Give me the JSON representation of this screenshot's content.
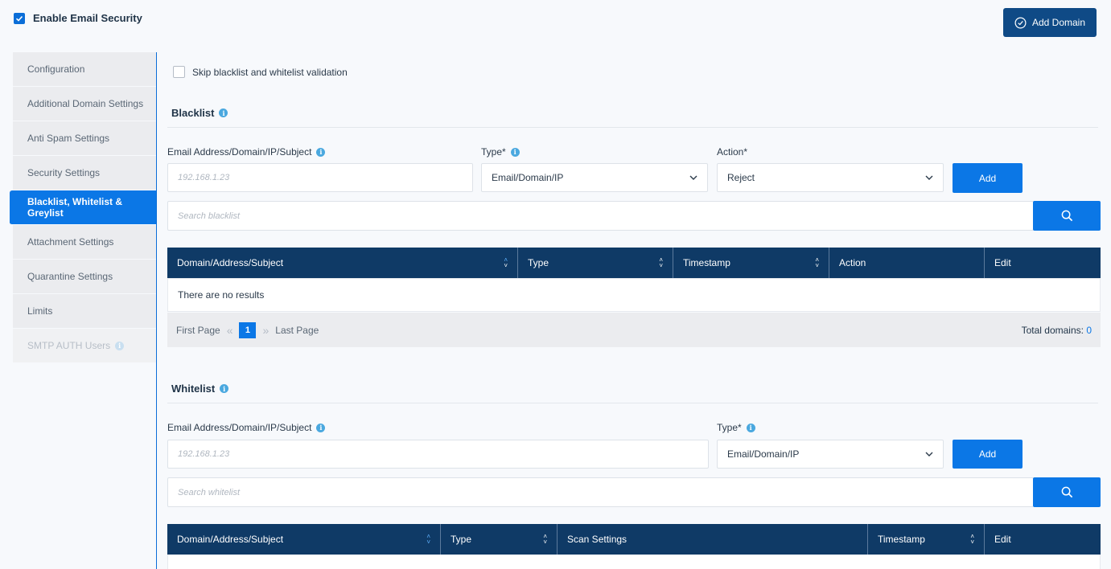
{
  "enable": {
    "label": "Enable Email Security",
    "checked": true
  },
  "add_domain": {
    "label": "Add Domain",
    "icon": "check-circle-icon"
  },
  "sidebar": {
    "items": [
      {
        "label": "Configuration",
        "state": "normal"
      },
      {
        "label": "Additional Domain Settings",
        "state": "normal"
      },
      {
        "label": "Anti Spam Settings",
        "state": "normal"
      },
      {
        "label": "Security Settings",
        "state": "normal"
      },
      {
        "label": "Blacklist, Whitelist & Greylist",
        "state": "active"
      },
      {
        "label": "Attachment Settings",
        "state": "normal"
      },
      {
        "label": "Quarantine Settings",
        "state": "normal"
      },
      {
        "label": "Limits",
        "state": "normal"
      },
      {
        "label": "SMTP AUTH Users",
        "state": "disabled"
      }
    ]
  },
  "skip": {
    "label": "Skip blacklist and whitelist validation",
    "checked": false
  },
  "blacklist": {
    "title": "Blacklist",
    "email_label": "Email Address/Domain/IP/Subject",
    "email_placeholder": "192.168.1.23",
    "type_label": "Type*",
    "type_value": "Email/Domain/IP",
    "action_label": "Action*",
    "action_value": "Reject",
    "add_label": "Add",
    "search_placeholder": "Search blacklist",
    "columns": [
      "Domain/Address/Subject",
      "Type",
      "Timestamp",
      "Action",
      "Edit"
    ],
    "empty_text": "There are no results",
    "pager": {
      "first": "First Page",
      "page": "1",
      "last": "Last Page",
      "total_label": "Total domains:",
      "total_value": "0"
    }
  },
  "whitelist": {
    "title": "Whitelist",
    "email_label": "Email Address/Domain/IP/Subject",
    "email_placeholder": "192.168.1.23",
    "type_label": "Type*",
    "type_value": "Email/Domain/IP",
    "add_label": "Add",
    "search_placeholder": "Search whitelist",
    "columns": [
      "Domain/Address/Subject",
      "Type",
      "Scan Settings",
      "Timestamp",
      "Edit"
    ]
  },
  "colors": {
    "accent": "#0b77e6",
    "header": "#0f3a66",
    "dark_button": "#0f4a86"
  }
}
